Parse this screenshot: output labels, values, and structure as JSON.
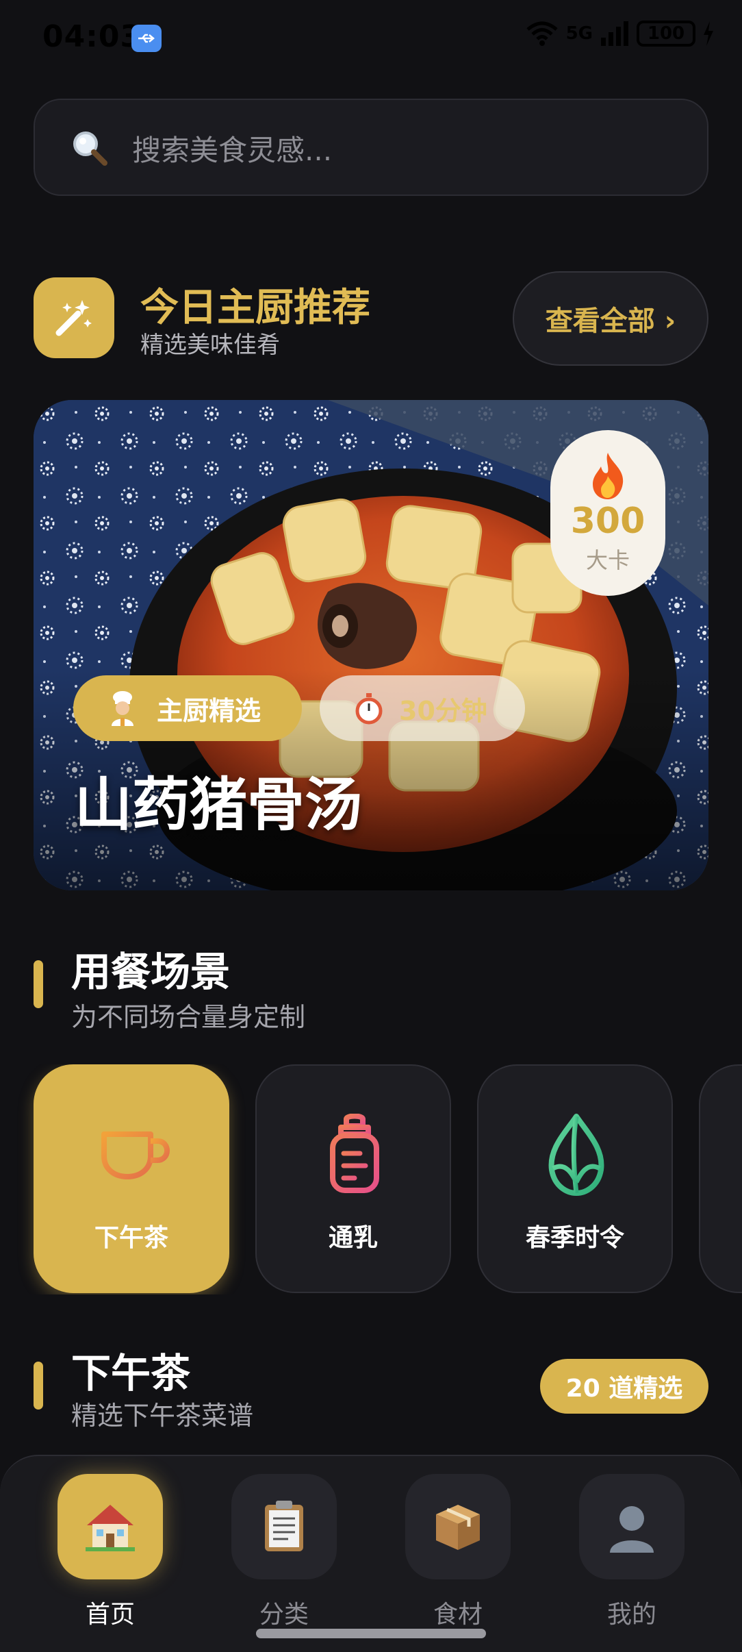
{
  "status_bar": {
    "time": "04:03",
    "network": "5G",
    "battery": "100"
  },
  "search": {
    "placeholder": "搜索美食灵感..."
  },
  "chef_section": {
    "title": "今日主厨推荐",
    "subtitle": "精选美味佳肴",
    "view_all": "查看全部 ›"
  },
  "hero": {
    "dish_name": "山药猪骨汤",
    "calories_value": "300",
    "calories_unit": "大卡",
    "tag_chef": "主厨精选",
    "tag_time": "30分钟"
  },
  "scene_section": {
    "title": "用餐场景",
    "subtitle": "为不同场合量身定制",
    "items": [
      {
        "label": "下午茶",
        "icon": "teacup-icon",
        "active": true
      },
      {
        "label": "通乳",
        "icon": "baby-bottle-icon",
        "active": false
      },
      {
        "label": "春季时令",
        "icon": "bamboo-shoot-icon",
        "active": false
      }
    ]
  },
  "tea_section": {
    "title": "下午茶",
    "subtitle": "精选下午茶菜谱",
    "count_badge": "20 道精选"
  },
  "bottom_nav": {
    "items": [
      {
        "label": "首页",
        "icon": "house-icon",
        "active": true
      },
      {
        "label": "分类",
        "icon": "clipboard-icon",
        "active": false
      },
      {
        "label": "食材",
        "icon": "package-icon",
        "active": false
      },
      {
        "label": "我的",
        "icon": "user-silhouette-icon",
        "active": false
      }
    ]
  },
  "colors": {
    "background": "#111114",
    "accent_gold": "#d9b54f",
    "card_dark": "#1d1d22"
  }
}
